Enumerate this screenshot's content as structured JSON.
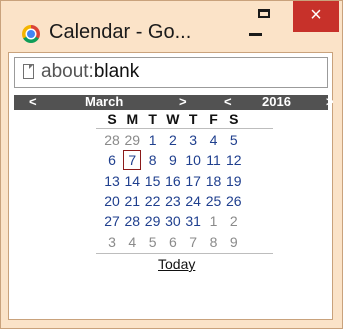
{
  "window": {
    "title": "Calendar - Go...",
    "minimize_label": "",
    "maximize_label": "",
    "close_label": "×"
  },
  "address": {
    "scheme": "about:",
    "host": "blank"
  },
  "calendar": {
    "prev_month": "<",
    "month": "March",
    "next_month": ">",
    "prev_year": "<",
    "year": "2016",
    "next_year": ">",
    "weekdays": [
      "S",
      "M",
      "T",
      "W",
      "T",
      "F",
      "S"
    ],
    "weeks": [
      [
        "28",
        "29",
        "1",
        "2",
        "3",
        "4",
        "5"
      ],
      [
        "6",
        "7",
        "8",
        "9",
        "10",
        "11",
        "12"
      ],
      [
        "13",
        "14",
        "15",
        "16",
        "17",
        "18",
        "19"
      ],
      [
        "20",
        "21",
        "22",
        "23",
        "24",
        "25",
        "26"
      ],
      [
        "27",
        "28",
        "29",
        "30",
        "31",
        "1",
        "2"
      ],
      [
        "3",
        "4",
        "5",
        "6",
        "7",
        "8",
        "9"
      ]
    ],
    "selected_day": "7",
    "today_label": "Today"
  },
  "colors": {
    "header_bg": "#525252",
    "current_month_day": "#1f3f8e",
    "other_month_day": "#8a8a8a",
    "selected_border": "#8b1a1a",
    "close_button": "#c7312a",
    "frame": "#fbe3c8"
  }
}
